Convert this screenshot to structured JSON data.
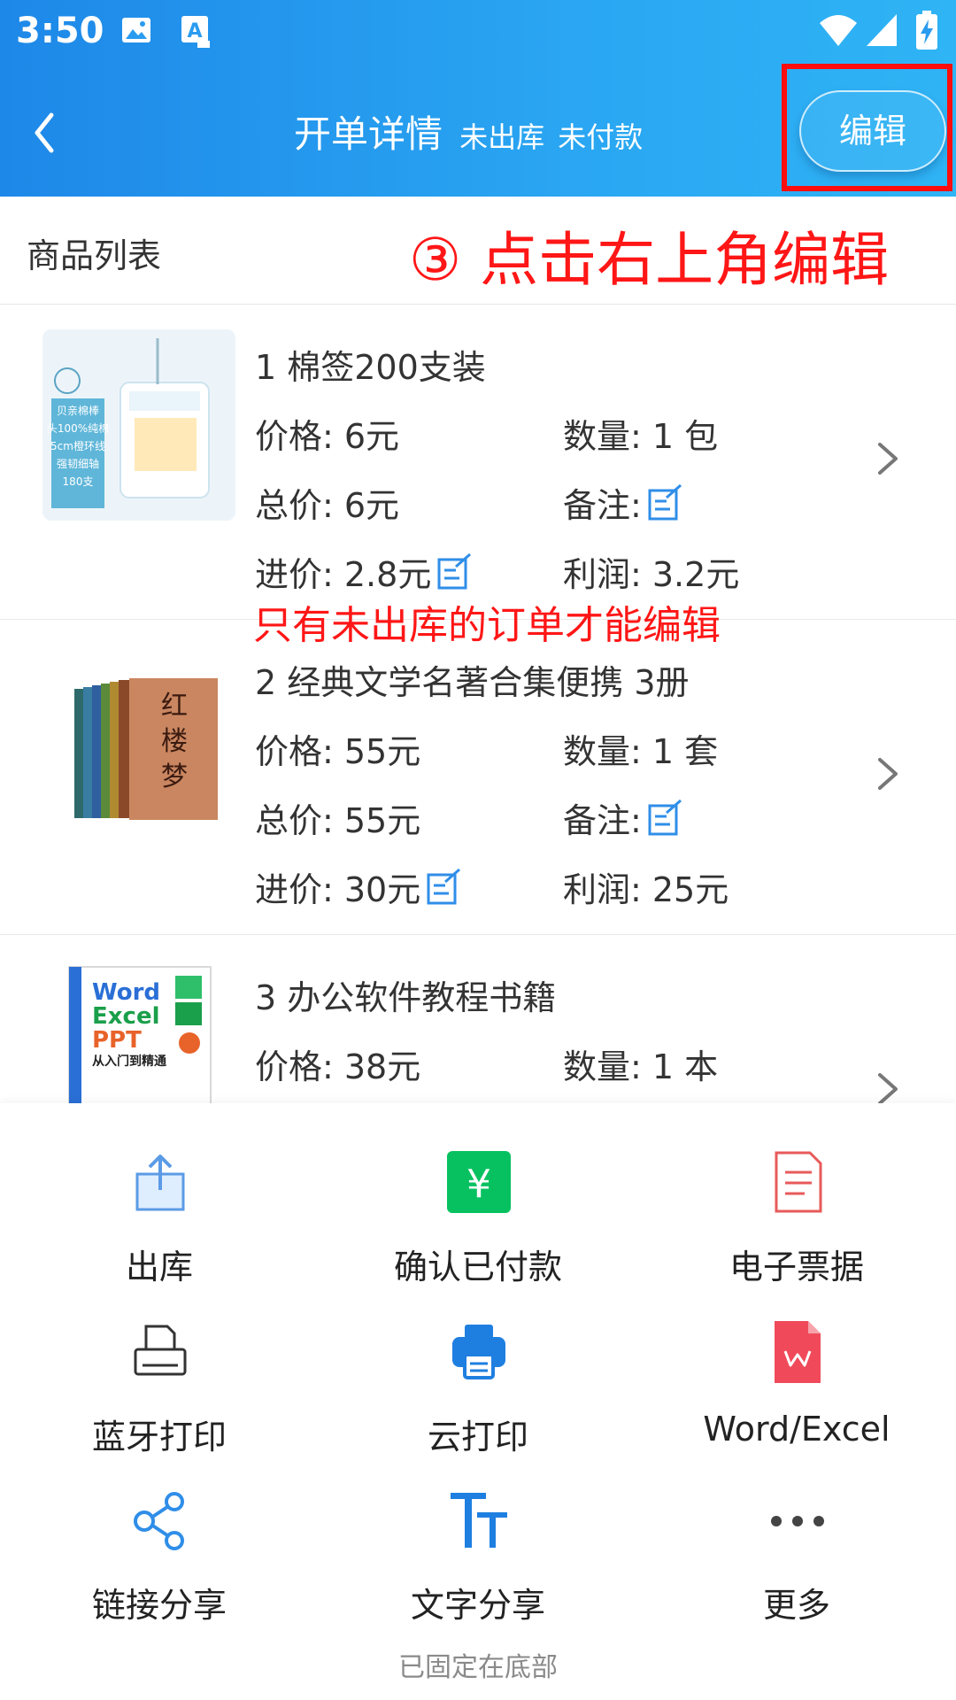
{
  "status_bar": {
    "time": "3:50"
  },
  "nav": {
    "title": "开单详情",
    "status_outbound": "未出库",
    "status_payment": "未付款",
    "edit_label": "编辑"
  },
  "list": {
    "title": "商品列表",
    "annotation_step": "③ 点击右上角编辑",
    "annotation_note": "只有未出库的订单才能编辑"
  },
  "products": [
    {
      "name": "1 棉签200支装",
      "price": "价格: 6元",
      "qty": "数量: 1 包",
      "total": "总价: 6元",
      "note": "备注:",
      "cost": "进价: 2.8元",
      "profit": "利润: 3.2元",
      "thumb_text": [
        "贝亲棉棒",
        "头100%纯棉",
        "5cm橙环线",
        "强韧细轴",
        "180支"
      ]
    },
    {
      "name": "2 经典文学名著合集便携 3册",
      "price": "价格: 55元",
      "qty": "数量: 1 套",
      "total": "总价: 55元",
      "note": "备注:",
      "cost": "进价: 30元",
      "profit": "利润: 25元",
      "thumb_text": [
        "红",
        "楼",
        "梦"
      ]
    },
    {
      "name": "3 办公软件教程书籍",
      "price": "价格: 38元",
      "qty": "数量: 1 本",
      "thumb_text": [
        "Word",
        "Excel",
        "PPT",
        "从入门到精通"
      ]
    }
  ],
  "actions": [
    {
      "label": "出库",
      "icon": "share-upload-icon"
    },
    {
      "label": "确认已付款",
      "icon": "yuan-icon"
    },
    {
      "label": "电子票据",
      "icon": "receipt-icon"
    },
    {
      "label": "蓝牙打印",
      "icon": "printer-icon"
    },
    {
      "label": "云打印",
      "icon": "cloud-print-icon"
    },
    {
      "label": "Word/Excel",
      "icon": "wps-icon"
    },
    {
      "label": "链接分享",
      "icon": "share-nodes-icon"
    },
    {
      "label": "文字分享",
      "icon": "text-size-icon"
    },
    {
      "label": "更多",
      "icon": "more-icon"
    }
  ],
  "footer": {
    "pinned": "已固定在底部"
  },
  "colors": {
    "header_start": "#1e88e8",
    "header_end": "#2fb4f5",
    "annotation_red": "#ff1616",
    "edit_icon_blue": "#2f8ee8",
    "yuan_green": "#07c160",
    "receipt_red": "#e85a5a",
    "wps_red": "#f04a5a"
  }
}
